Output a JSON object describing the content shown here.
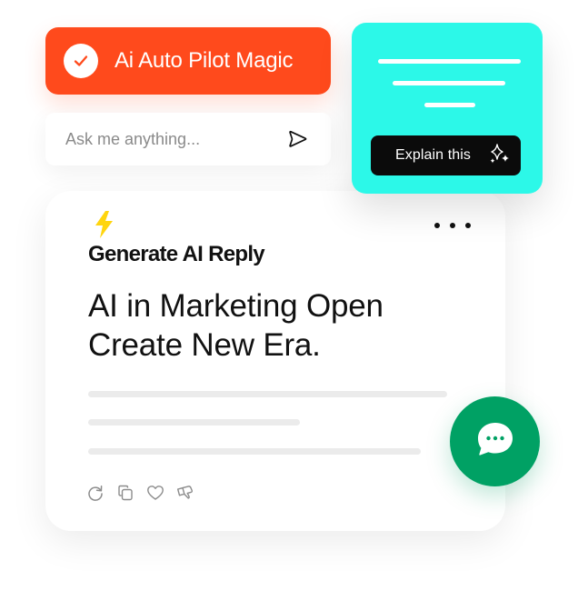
{
  "pilot": {
    "label": "Ai Auto Pilot Magic",
    "icon": "check-icon",
    "accent": "#ff4a1c"
  },
  "ask": {
    "placeholder": "Ask me anything...",
    "send_icon": "send-icon"
  },
  "explain": {
    "button_label": "Explain this",
    "icon": "sparkle-icon",
    "accent": "#2cf8e8"
  },
  "reply": {
    "icon": "lightning-icon",
    "title": "Generate AI Reply",
    "body": "AI in Marketing Open Create New Era.",
    "more_icon": "more-horizontal-icon",
    "actions": [
      {
        "icon": "regenerate-icon"
      },
      {
        "icon": "copy-icon"
      },
      {
        "icon": "heart-icon"
      },
      {
        "icon": "dislike-icon"
      }
    ]
  },
  "chat": {
    "icon": "chat-bubble-icon",
    "accent": "#00a164"
  }
}
